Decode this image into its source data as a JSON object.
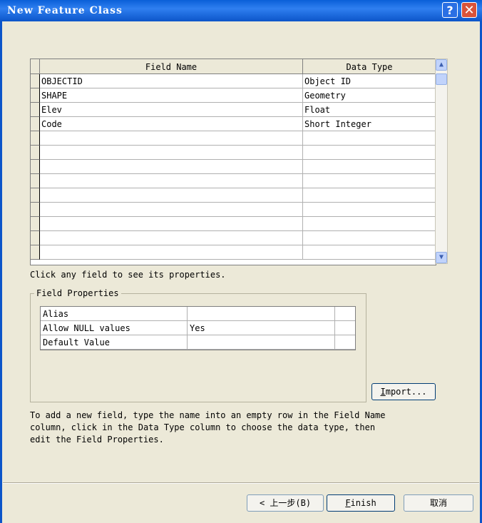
{
  "window": {
    "title": "New Feature Class",
    "help_icon": "?",
    "close_icon": "✕"
  },
  "grid": {
    "headers": [
      "Field Name",
      "Data Type"
    ],
    "rows": [
      {
        "name": "OBJECTID",
        "type": "Object ID"
      },
      {
        "name": "SHAPE",
        "type": "Geometry"
      },
      {
        "name": "Elev",
        "type": "Float"
      },
      {
        "name": "Code",
        "type": "Short Integer"
      },
      {
        "name": "",
        "type": ""
      },
      {
        "name": "",
        "type": ""
      },
      {
        "name": "",
        "type": ""
      },
      {
        "name": "",
        "type": ""
      },
      {
        "name": "",
        "type": ""
      },
      {
        "name": "",
        "type": ""
      },
      {
        "name": "",
        "type": ""
      },
      {
        "name": "",
        "type": ""
      },
      {
        "name": "",
        "type": ""
      }
    ]
  },
  "hint": "Click any field to see its properties.",
  "field_properties": {
    "legend": "Field Properties",
    "rows": [
      {
        "label": "Alias",
        "value": ""
      },
      {
        "label": "Allow NULL values",
        "value": "Yes"
      },
      {
        "label": "Default Value",
        "value": ""
      }
    ]
  },
  "import_button": {
    "underlined": "I",
    "rest": "mport..."
  },
  "instructions": [
    "To add a new field, type the name into an empty row in the Field Name",
    "column, click in the Data Type column to choose the data type, then",
    "edit the Field Properties."
  ],
  "footer": {
    "back_label": "< 上一步(B)",
    "finish_underlined": "F",
    "finish_rest": "inish",
    "cancel_label": "取消"
  }
}
